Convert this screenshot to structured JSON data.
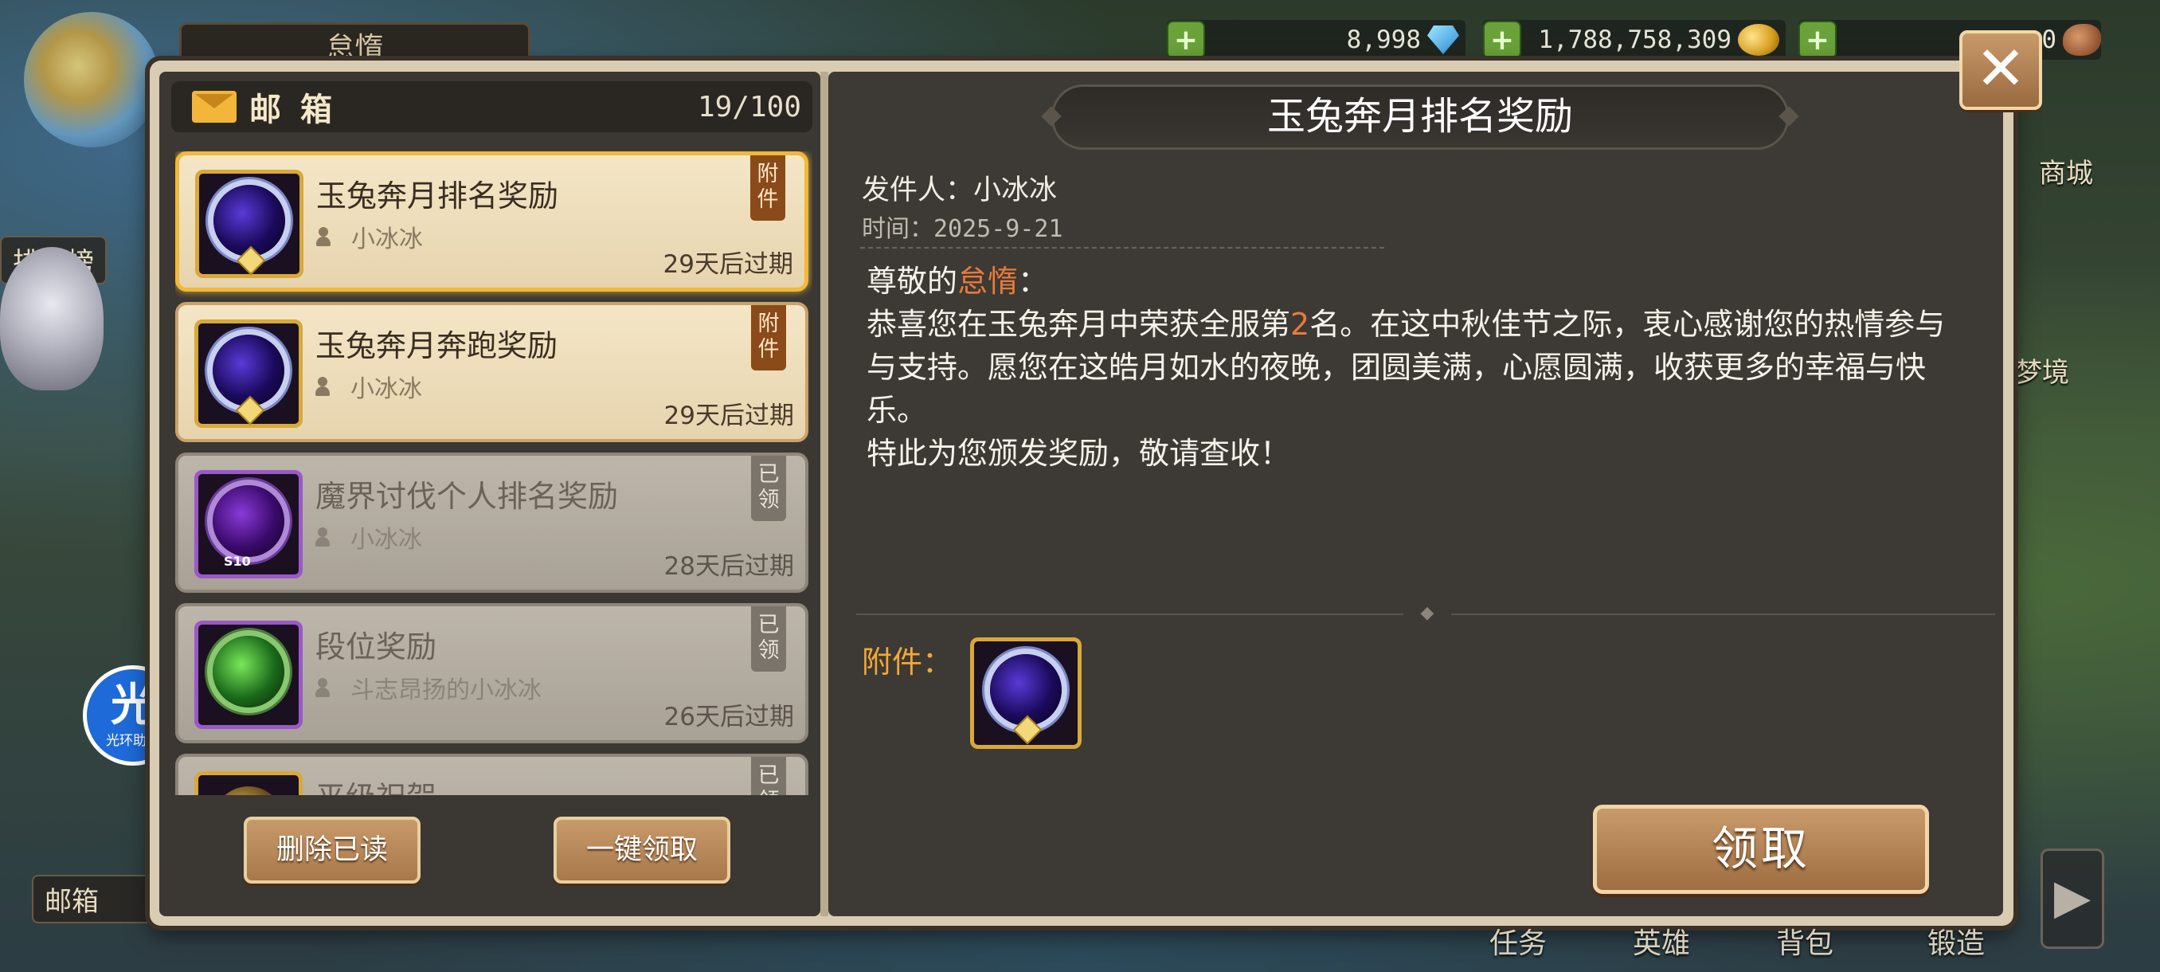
{
  "background": {
    "top_tab": "怠惰",
    "ranking": "排行榜",
    "mailbox": "邮箱",
    "shop": "商城",
    "dream": "梦境",
    "helper_glyph": "光",
    "helper_name": "光环助手",
    "bottom_nav": [
      "任务",
      "英雄",
      "背包",
      "锻造"
    ]
  },
  "resources": {
    "gems": "8,998",
    "gold": "1,788,758,309",
    "food": "0"
  },
  "mailbox": {
    "title": "邮箱",
    "count": "19/100",
    "items": [
      {
        "title": "玉兔奔月排名奖励",
        "sender": "小冰冰",
        "expiry": "29天后过期",
        "tag": "附件",
        "state": "unread-selected",
        "icon": "blue-ring-medal"
      },
      {
        "title": "玉兔奔月奔跑奖励",
        "sender": "小冰冰",
        "expiry": "29天后过期",
        "tag": "附件",
        "state": "unread",
        "icon": "blue-ring-medal"
      },
      {
        "title": "魔界讨伐个人排名奖励",
        "sender": "小冰冰",
        "expiry": "28天后过期",
        "tag": "已领",
        "state": "read",
        "icon": "purple-s10-medal",
        "icon_text": "S10"
      },
      {
        "title": "段位奖励",
        "sender": "斗志昂扬的小冰冰",
        "expiry": "26天后过期",
        "tag": "已领",
        "state": "read",
        "icon": "green-laurel-medal"
      },
      {
        "title": "平级祝贺",
        "sender": "",
        "expiry": "",
        "tag": "已领",
        "state": "read",
        "icon": "gold-medal"
      }
    ],
    "delete_read": "删除已读",
    "claim_all": "一键领取"
  },
  "detail": {
    "title": "玉兔奔月排名奖励",
    "sender_label": "发件人：小冰冰",
    "time_label": "时间：2025-9-21",
    "greeting_prefix": "尊敬的",
    "greeting_name": "怠惰",
    "greeting_suffix": "：",
    "line1_a": "恭喜您在玉兔奔月中荣获全服第",
    "rank": "2",
    "line1_b": "名。在这中秋佳节之际，衷心感谢您的热情参与与支持。愿您在这皓月如水的夜晚，团圆美满，心愿圆满，收获更多的幸福与快乐。",
    "line2": "特此为您颁发奖励，敬请查收！",
    "attachment_label": "附件：",
    "claim": "领取"
  },
  "colors": {
    "accent_gold": "#f2b838",
    "highlight_orange": "#e87a3a",
    "button_brown": "#a8784a"
  }
}
